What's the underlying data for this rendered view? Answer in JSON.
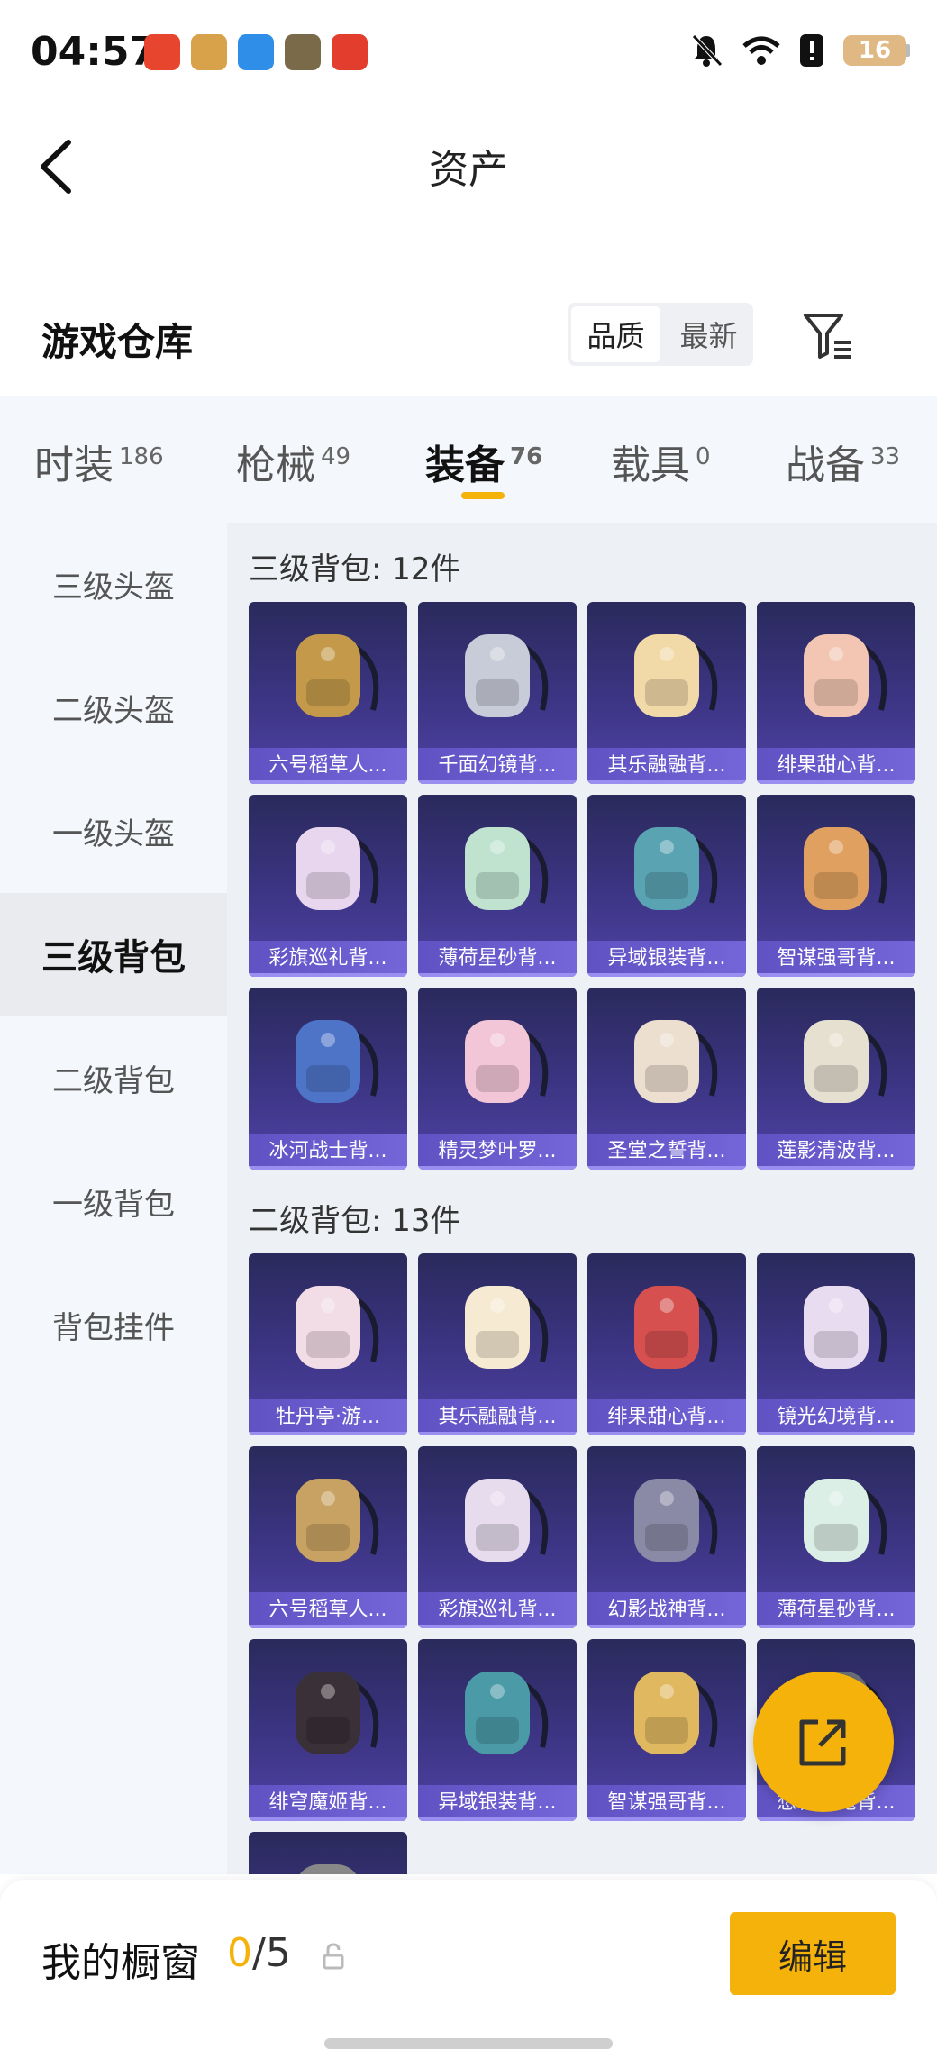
{
  "status": {
    "time": "04:57",
    "battery": "16",
    "app_icon_colors": [
      "#e8452f",
      "#d8a24a",
      "#2f8fe8",
      "#7a6a4a",
      "#e33d2d"
    ]
  },
  "header": {
    "title": "资产"
  },
  "warehouse": {
    "title": "游戏仓库",
    "sort_options": [
      "品质",
      "最新"
    ]
  },
  "tabs": [
    {
      "label": "时装",
      "count": "186"
    },
    {
      "label": "枪械",
      "count": "49"
    },
    {
      "label": "装备",
      "count": "76"
    },
    {
      "label": "载具",
      "count": "0"
    },
    {
      "label": "战备",
      "count": "33"
    }
  ],
  "sidebar": {
    "items": [
      {
        "label": "三级头盔"
      },
      {
        "label": "二级头盔"
      },
      {
        "label": "一级头盔"
      },
      {
        "label": "三级背包"
      },
      {
        "label": "二级背包"
      },
      {
        "label": "一级背包"
      },
      {
        "label": "背包挂件"
      }
    ]
  },
  "sections": [
    {
      "title": "三级背包: 12件",
      "items": [
        {
          "name": "六号稻草人...",
          "art": "#c49a4a"
        },
        {
          "name": "千面幻镜背...",
          "art": "#c8ccd8"
        },
        {
          "name": "其乐融融背...",
          "art": "#f1d9a8"
        },
        {
          "name": "绯果甜心背...",
          "art": "#f2c6b2"
        },
        {
          "name": "彩旗巡礼背...",
          "art": "#e8d6ee"
        },
        {
          "name": "薄荷星砂背...",
          "art": "#bfe3cf"
        },
        {
          "name": "异域银装背...",
          "art": "#5aa3b3"
        },
        {
          "name": "智谋强哥背...",
          "art": "#e0a060"
        },
        {
          "name": "冰河战士背...",
          "art": "#4e74c8"
        },
        {
          "name": "精灵梦叶罗...",
          "art": "#f2c6d6"
        },
        {
          "name": "圣堂之誓背...",
          "art": "#ecdfcf"
        },
        {
          "name": "莲影清波背...",
          "art": "#e6e0d0"
        }
      ]
    },
    {
      "title": "二级背包: 13件",
      "items": [
        {
          "name": "牡丹亭·游...",
          "art": "#f2dce6"
        },
        {
          "name": "其乐融融背...",
          "art": "#f6ead2"
        },
        {
          "name": "绯果甜心背...",
          "art": "#d65050"
        },
        {
          "name": "镜光幻境背...",
          "art": "#e8dcf0"
        },
        {
          "name": "六号稻草人...",
          "art": "#c8a262"
        },
        {
          "name": "彩旗巡礼背...",
          "art": "#e6dcee"
        },
        {
          "name": "幻影战神背...",
          "art": "#8a8aa6"
        },
        {
          "name": "薄荷星砂背...",
          "art": "#dcefe6"
        },
        {
          "name": "绯穹魔姬背...",
          "art": "#3a3038"
        },
        {
          "name": "异域银装背...",
          "art": "#4a9aa8"
        },
        {
          "name": "智谋强哥背...",
          "art": "#e0b860"
        },
        {
          "name": "愁容小鬼背...",
          "art": "#6a7078"
        },
        {
          "name": "",
          "art": "#888888"
        }
      ]
    }
  ],
  "showcase": {
    "title": "我的橱窗",
    "current": "0",
    "separator": "/",
    "total": "5",
    "edit_label": "编辑"
  }
}
